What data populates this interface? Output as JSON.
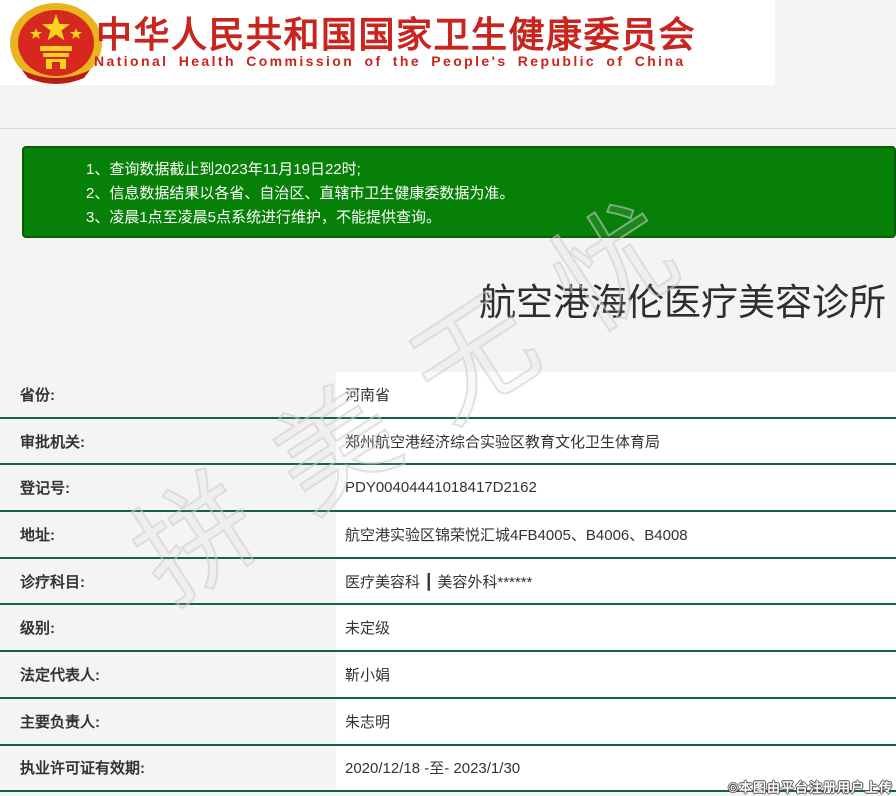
{
  "header": {
    "title_cn": "中华人民共和国国家卫生健康委员会",
    "title_en": "National Health Commission of the People's Republic of China"
  },
  "notice": {
    "items": [
      "1、查询数据截止到2023年11月19日22时;",
      "2、信息数据结果以各省、自治区、直辖市卫生健康委数据为准。",
      "3、凌晨1点至凌晨5点系统进行维护，不能提供查询。"
    ]
  },
  "result": {
    "institution_name": "航空港海伦医疗美容诊所",
    "fields": [
      {
        "label": "省份:",
        "value": "河南省"
      },
      {
        "label": "审批机关:",
        "value": "郑州航空港经济综合实验区教育文化卫生体育局"
      },
      {
        "label": "登记号:",
        "value": "PDY00404441018417D2162"
      },
      {
        "label": "地址:",
        "value": "航空港实验区锦荣悦汇城4FB4005、B4006、B4008"
      },
      {
        "label": "诊疗科目:",
        "value": "医疗美容科 ┃ 美容外科******"
      },
      {
        "label": "级别:",
        "value": "未定级"
      },
      {
        "label": "法定代表人:",
        "value": "靳小娟"
      },
      {
        "label": "主要负责人:",
        "value": "朱志明"
      },
      {
        "label": "执业许可证有效期:",
        "value": "2020/12/18 -至- 2023/1/30"
      }
    ]
  },
  "watermark": {
    "text": "拼美无忧"
  },
  "footer": {
    "copyright": "©本图由平台注册用户上传"
  },
  "colors": {
    "brand_red": "#c9241d",
    "notice_green": "#078007",
    "notice_border": "#0a5c0a",
    "separator_green": "#17614b"
  }
}
